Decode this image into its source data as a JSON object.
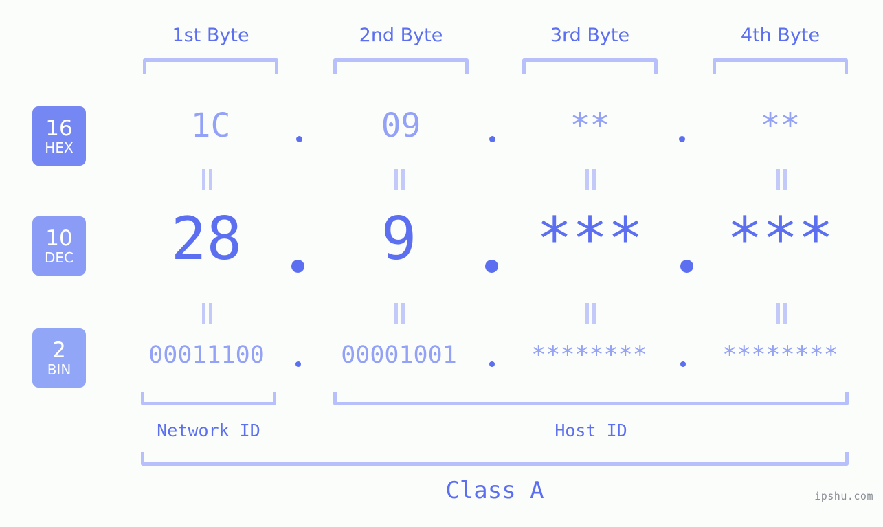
{
  "meta": {
    "watermark": "ipshu.com",
    "accent_strong": "#5b6ff0",
    "accent_mid": "#93a1f7",
    "accent_light": "#b7c0fb",
    "background": "#fbfdfa"
  },
  "byte_headers": [
    {
      "label": "1st Byte"
    },
    {
      "label": "2nd Byte"
    },
    {
      "label": "3rd Byte"
    },
    {
      "label": "4th Byte"
    }
  ],
  "radix_rows": [
    {
      "number": "16",
      "name": "HEX",
      "color": "#7487f2"
    },
    {
      "number": "10",
      "name": "DEC",
      "color": "#8b9cf6"
    },
    {
      "number": "2",
      "name": "BIN",
      "color": "#92a6f8"
    }
  ],
  "values": {
    "hex": [
      "1C",
      "09",
      "**",
      "**"
    ],
    "dec": [
      "28",
      "9",
      "***",
      "***"
    ],
    "bin": [
      "00011100",
      "00001001",
      "********",
      "********"
    ]
  },
  "separators": {
    "hex": [
      ".",
      ".",
      "."
    ],
    "dec": [
      ".",
      ".",
      "."
    ],
    "bin": [
      ".",
      ".",
      "."
    ]
  },
  "equals_marks": {
    "glyph": "=",
    "rows": [
      "hex-to-dec",
      "dec-to-bin"
    ]
  },
  "id_regions": [
    {
      "label": "Network ID"
    },
    {
      "label": "Host ID"
    }
  ],
  "class_region": {
    "label": "Class A"
  }
}
